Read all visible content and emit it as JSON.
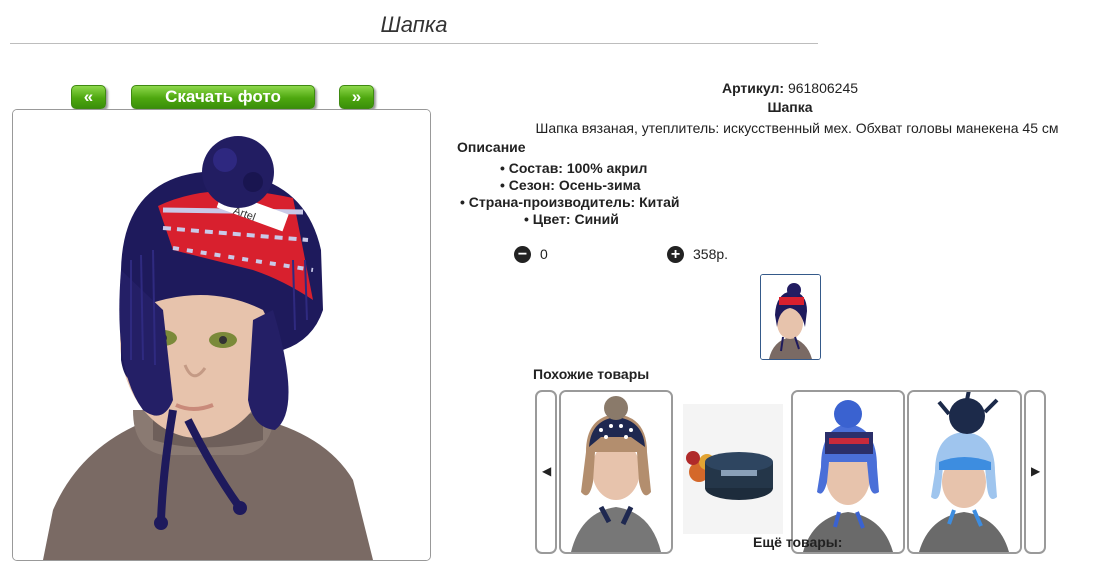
{
  "page": {
    "title": "Шапка"
  },
  "nav": {
    "prev": "«",
    "download": "Скачать фото",
    "next": "»"
  },
  "product": {
    "article_label": "Артикул:",
    "article_value": "961806245",
    "name": "Шапка",
    "description": "Шапка вязаная, утеплитель: искусственный мех. Обхват головы манекена 45 см",
    "description_heading": "Описание",
    "features": [
      "Состав: 100% акрил",
      "Сезон: Осень-зима",
      "Страна-производитель: Китай",
      "Цвет: Синий"
    ],
    "quantity": "0",
    "price": "358р."
  },
  "similar": {
    "heading": "Похожие товары",
    "items": [
      "hat-fur-earflaps",
      "hat-folded",
      "hat-blue-pompom",
      "hat-light-blue-fur"
    ]
  },
  "more_label": "Ещё товары:",
  "icons": {
    "minus": "minus-circle-icon",
    "plus": "plus-circle-icon",
    "prev": "arrow-left-icon",
    "next": "arrow-right-icon"
  },
  "colors": {
    "button_green": "#4ea70f",
    "hat_navy": "#1e1a5c",
    "hat_red": "#d8202e"
  }
}
